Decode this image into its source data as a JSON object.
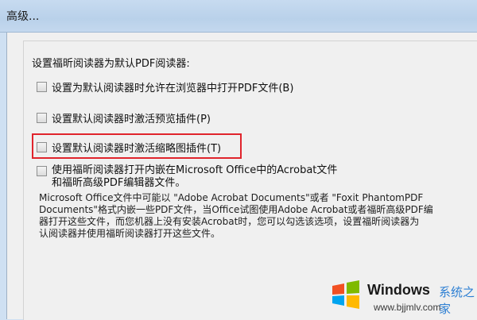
{
  "window": {
    "title": "高级..."
  },
  "settings": {
    "heading": "设置福昕阅读器为默认PDF阅读器:",
    "options": [
      {
        "label": "设置为默认阅读器时允许在浏览器中打开PDF文件(B)",
        "checked": false
      },
      {
        "label": "设置默认阅读器时激活预览插件(P)",
        "checked": false
      },
      {
        "label": "设置默认阅读器时激活缩略图插件(T)",
        "checked": false,
        "highlighted": true
      },
      {
        "label_line1": "使用福昕阅读器打开内嵌在Microsoft Office中的Acrobat文件",
        "label_line2": "和福昕高级PDF编辑器文件。",
        "checked": false
      }
    ],
    "description": [
      "Microsoft Office文件中可能以 \"Adobe Acrobat Documents\"或者 \"Foxit PhantomPDF",
      "Documents\"格式内嵌一些PDF文件，当Office试图使用Adobe Acrobat或者福昕高级PDF编",
      "器打开这些文件，而您机器上没有安装Acrobat时，您可以勾选该选项，设置福昕阅读器为",
      "认阅读器并使用福昕阅读器打开这些文件。"
    ]
  },
  "watermark": {
    "brand": "Windows",
    "chinese": "系统之家",
    "url": "www.bjjmlv.com",
    "logo_colors": [
      "#f25022",
      "#7fba00",
      "#00a4ef",
      "#ffb900"
    ]
  }
}
